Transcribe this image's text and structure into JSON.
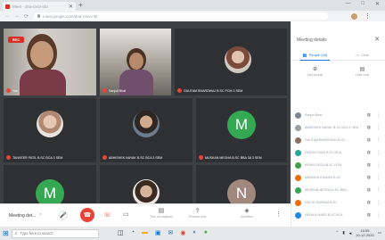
{
  "browser": {
    "tab_title": "Meet - dna-cxsv-nbt",
    "url": "meet.google.com/dna-cxsv-nbt",
    "window_controls": [
      "—",
      "□",
      "✕"
    ]
  },
  "stage": {
    "rec_badge": "REC",
    "tiles": [
      {
        "name": "You",
        "kind": "camera"
      },
      {
        "name": "Sanjoli Bhat",
        "kind": "camera"
      },
      {
        "name": "GAUTAM BHARDWAJ B.SC PCM 3 SEM",
        "kind": "photo"
      },
      {
        "name": "TANVEER PATIL B.SC BCA 3 SEM",
        "kind": "photo"
      },
      {
        "name": "ABHISHEK NAYAK B.SC BCA 3 SEM",
        "kind": "photo"
      },
      {
        "name": "MUSKAN MEGHA B.SC BBA 3A 3 SEM",
        "kind": "letter",
        "letter": "M",
        "color": "#34a853"
      },
      {
        "name": "",
        "kind": "letter",
        "letter": "M",
        "color": "#34a853"
      },
      {
        "name": "",
        "kind": "photo"
      },
      {
        "name": "",
        "kind": "letter",
        "letter": "N",
        "color": "#a1887f"
      }
    ]
  },
  "controls": {
    "meeting_title": "Meeting det...",
    "captions_label": "Turn on captions",
    "present_label": "Present now",
    "activities_label": "Activities"
  },
  "panel": {
    "title": "Meeting details",
    "tabs": [
      "People (18)",
      "Chat"
    ],
    "actions": [
      "Add people",
      "Hide chat"
    ],
    "people": [
      {
        "name": "Sanjoli Bhat",
        "color": "#7b8794"
      },
      {
        "name": "ABHISHEK NAYAK B.SC BCA 3 SEM",
        "color": "#9aa0a6"
      },
      {
        "name": "GAUTAM BHARDWAJ B.SC",
        "color": "#8d6e63"
      },
      {
        "name": "HEENA SHAH B.SC BCA",
        "color": "#26a69a"
      },
      {
        "name": "KIRAN DESAI B.SC PCM",
        "color": "#43a047"
      },
      {
        "name": "MANISHA KUMARI B.SC",
        "color": "#ef6c00"
      },
      {
        "name": "MUSKAN MEGHA B.SC BBA",
        "color": "#34a853"
      },
      {
        "name": "NIKITA SHARMA B.SC",
        "color": "#ef6c00"
      },
      {
        "name": "NEHA KUMARI B.SC BCA",
        "color": "#1e88e5"
      },
      {
        "name": "RAHUL SINGH B.SC",
        "color": "#7b8794"
      }
    ]
  },
  "taskbar": {
    "search_placeholder": "Type here to search",
    "time": "10:55",
    "date": "10-12-2020"
  }
}
